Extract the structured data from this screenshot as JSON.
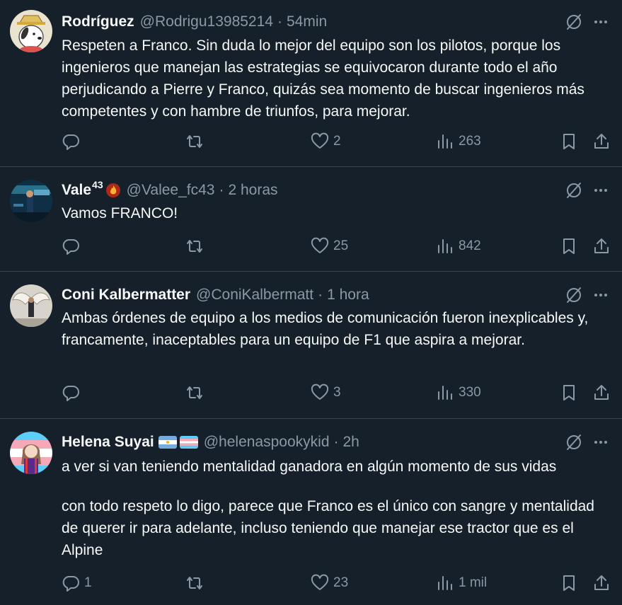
{
  "tweets": [
    {
      "name": "Rodríguez",
      "name_sup": "",
      "handle": "@Rodrigu13985214",
      "separator": "·",
      "time": "54min",
      "body": [
        "Respeten a Franco. Sin duda lo mejor del equipo son los pilotos, porque los ingenieros que manejan las estrategias se equivocaron durante todo el año perjudicando a Pierre y Franco, quizás sea momento de buscar ingenieros más competentes y con hambre de triunfos, para  mejorar."
      ],
      "replies": "",
      "retweets": "",
      "likes": "2",
      "views": "263"
    },
    {
      "name": "Vale",
      "name_sup": "43",
      "handle": "@Valee_fc43",
      "separator": "·",
      "time": "2 horas",
      "body": [
        "Vamos FRANCO!"
      ],
      "replies": "",
      "retweets": "",
      "likes": "25",
      "views": "842"
    },
    {
      "name": "Coni Kalbermatter",
      "name_sup": "",
      "handle": "@ConiKalbermatt",
      "separator": "·",
      "time": "1 hora",
      "body": [
        "Ambas órdenes de equipo a los medios de comunicación fueron inexplicables y, francamente, inaceptables para un equipo de F1 que aspira a mejorar."
      ],
      "replies": "",
      "retweets": "",
      "likes": "3",
      "views": "330"
    },
    {
      "name": "Helena Suyai",
      "name_sup": "",
      "handle": "@helenaspookykid",
      "separator": "·",
      "time": "2h",
      "body": [
        "a ver si van teniendo mentalidad ganadora en algún momento de sus vidas",
        "con todo respeto lo digo, parece que Franco es el único con sangre y mentalidad de querer ir para adelante, incluso teniendo que manejar ese tractor que es el Alpine"
      ],
      "replies": "1",
      "retweets": "",
      "likes": "23",
      "views": "1 mil"
    }
  ],
  "icons": {
    "reply": "reply-icon",
    "retweet": "retweet-icon",
    "like": "like-icon",
    "views": "views-icon",
    "bookmark": "bookmark-icon",
    "share": "share-icon",
    "grok": "grok-icon",
    "more": "more-icon"
  },
  "colors": {
    "background": "#15202b",
    "text": "#f7f9f9",
    "secondary": "#8b98a5",
    "divider": "#38444d"
  }
}
